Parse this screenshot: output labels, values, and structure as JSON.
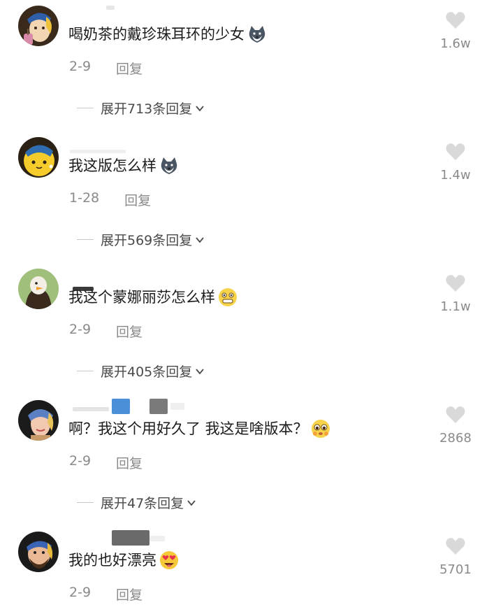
{
  "comments": [
    {
      "text": "喝奶茶的戴珍珠耳环的少女",
      "date": "2-9",
      "reply_label": "回复",
      "expand_label": "展开713条回复",
      "likes": "1.6w",
      "avatar_icon": "girl-with-pearl-earring-avatar",
      "emoji_icon": "husky-dog-emoji"
    },
    {
      "text": "我这版怎么样",
      "date": "1-28",
      "reply_label": "回复",
      "expand_label": "展开569条回复",
      "likes": "1.4w",
      "avatar_icon": "yellow-cat-pearl-earring-avatar",
      "emoji_icon": "husky-dog-emoji"
    },
    {
      "text": "我这个蒙娜丽莎怎么样",
      "date": "2-9",
      "reply_label": "回复",
      "expand_label": "展开405条回复",
      "likes": "1.1w",
      "avatar_icon": "duck-mona-lisa-avatar",
      "emoji_icon": "grinning-face-emoji"
    },
    {
      "text": "啊？我这个用好久了 我这是啥版本？",
      "date": "2-9",
      "reply_label": "回复",
      "expand_label": "展开47条回复",
      "likes": "2868",
      "avatar_icon": "painted-girl-earring-avatar",
      "emoji_icon": "pleading-face-emoji"
    },
    {
      "text": "我的也好漂亮",
      "date": "2-9",
      "reply_label": "回复",
      "expand_label": "",
      "likes": "5701",
      "avatar_icon": "bearded-man-headwrap-avatar",
      "emoji_icon": "heart-eyes-emoji"
    }
  ],
  "colors": {
    "text": "#1c1c1c",
    "meta": "#8a8a8a",
    "heart": "#d9d9d9"
  }
}
